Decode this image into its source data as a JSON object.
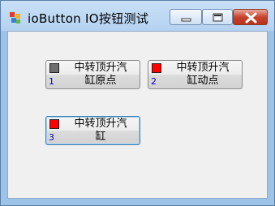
{
  "window": {
    "title": "ioButton  IO按钮测试"
  },
  "buttons": [
    {
      "label": "中转顶升汽\n缸原点",
      "number": "1",
      "indicator_color": "#6e6e6e"
    },
    {
      "label": "中转顶升汽\n缸动点",
      "number": "2",
      "indicator_color": "#ff0000"
    },
    {
      "label": "中转顶升汽\n缸",
      "number": "3",
      "indicator_color": "#ff0000"
    }
  ]
}
